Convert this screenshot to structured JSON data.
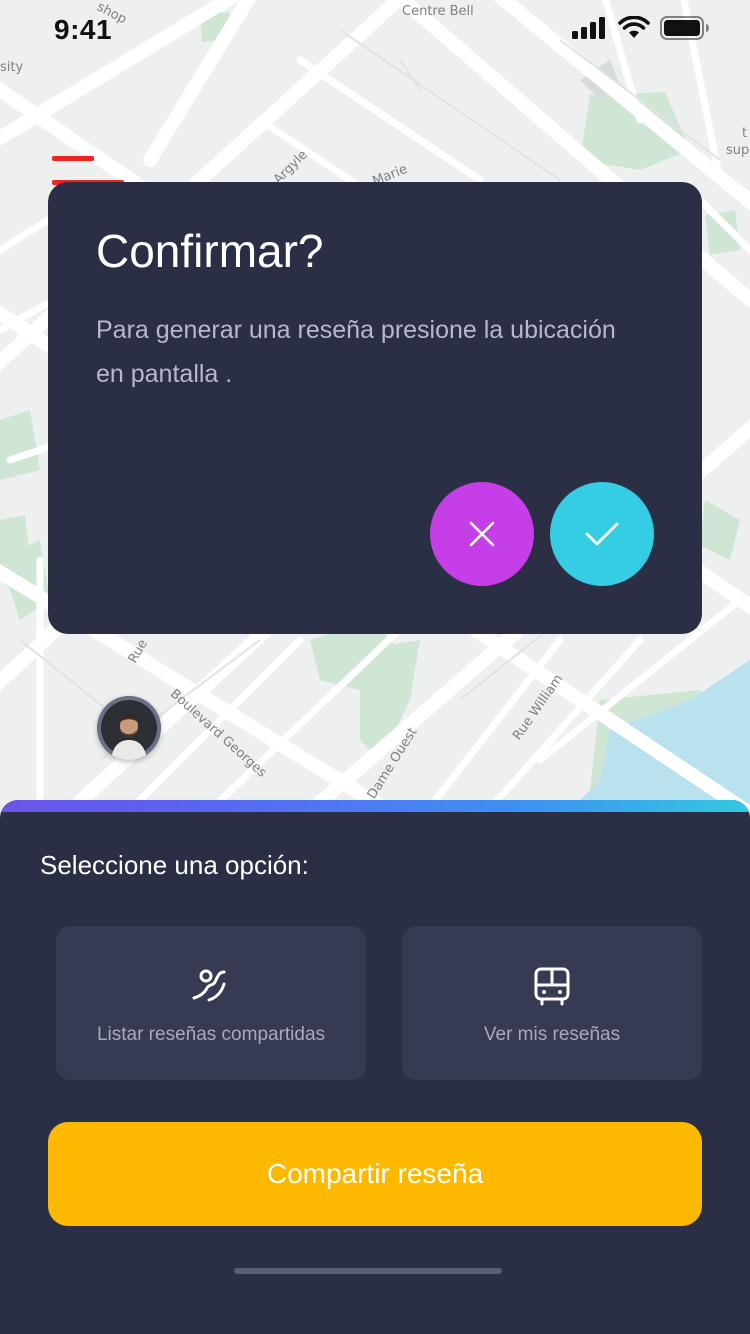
{
  "status_bar": {
    "time": "9:41"
  },
  "map": {
    "labels": {
      "shop": "shop",
      "centre_bell": "Centre Bell",
      "sity": "sity",
      "argyle": "Argyle",
      "marie": "Marie",
      "right_t": "t",
      "right_sup": "sup",
      "rue": "Rue",
      "boulevard": "Boulevard Georges",
      "dame_ouest": "Dame Ouest",
      "rue_william": "Rue William"
    }
  },
  "dialog": {
    "title": "Confirmar?",
    "message": "Para generar una reseña presione la ubicación en pantalla ."
  },
  "sheet": {
    "title": "Seleccione una opción:",
    "option_shared": "Listar reseñas compartidas",
    "option_mine": "Ver mis reseñas",
    "share_button": "Compartir reseña"
  },
  "colors": {
    "menu": "#f0231e",
    "dialog_bg": "#2b2f45",
    "cancel": "#c53ee8",
    "confirm": "#35cde3",
    "share": "#fdb900"
  },
  "icons": [
    "menu-icon",
    "close-icon",
    "check-icon",
    "person-route-icon",
    "bus-icon",
    "signal-icon",
    "wifi-icon",
    "battery-icon"
  ]
}
